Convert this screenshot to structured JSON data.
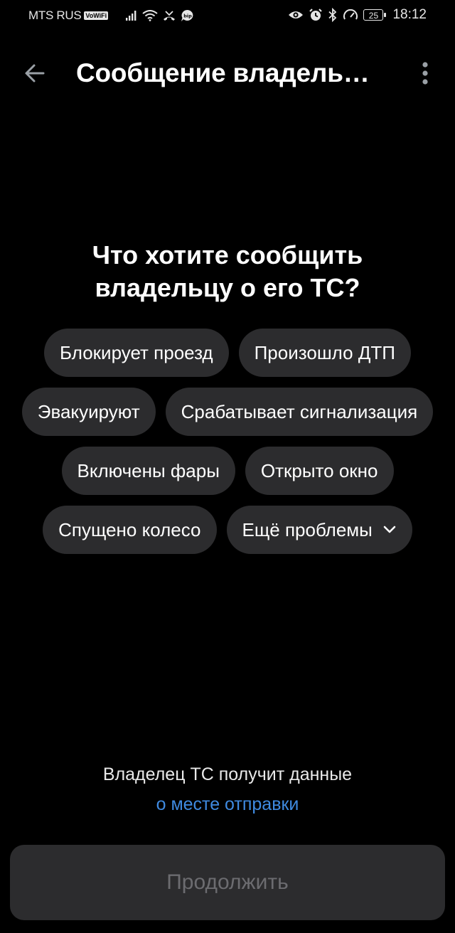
{
  "status_bar": {
    "carrier": "MTS RUS",
    "vowifi": "VoWiFi",
    "battery": "25",
    "time": "18:12",
    "icons": [
      "signal-icon",
      "wifi-icon",
      "missed-call-icon",
      "bip-app-icon",
      "eye-icon",
      "alarm-icon",
      "bluetooth-icon",
      "speed-icon",
      "battery-icon"
    ]
  },
  "app_bar": {
    "title": "Сообщение владель…",
    "back_icon": "arrow-left-icon",
    "menu_icon": "more-vertical-icon"
  },
  "question": {
    "line1": "Что хотите сообщить",
    "line2": "владельцу о его ТС?"
  },
  "chips": [
    "Блокирует проезд",
    "Произошло ДТП",
    "Эвакуируют",
    "Срабатывает сигнализация",
    "Включены фары",
    "Открыто окно",
    "Спущено колесо"
  ],
  "more_chip": {
    "label": "Ещё проблемы",
    "icon": "chevron-down-icon"
  },
  "info": {
    "text": "Владелец ТС получит данные",
    "link": "о месте отправки"
  },
  "continue_button": "Продолжить",
  "colors": {
    "background": "#000000",
    "chip": "#2c2c2e",
    "link": "#3f8ae0",
    "disabled_text": "#6c6c70"
  }
}
